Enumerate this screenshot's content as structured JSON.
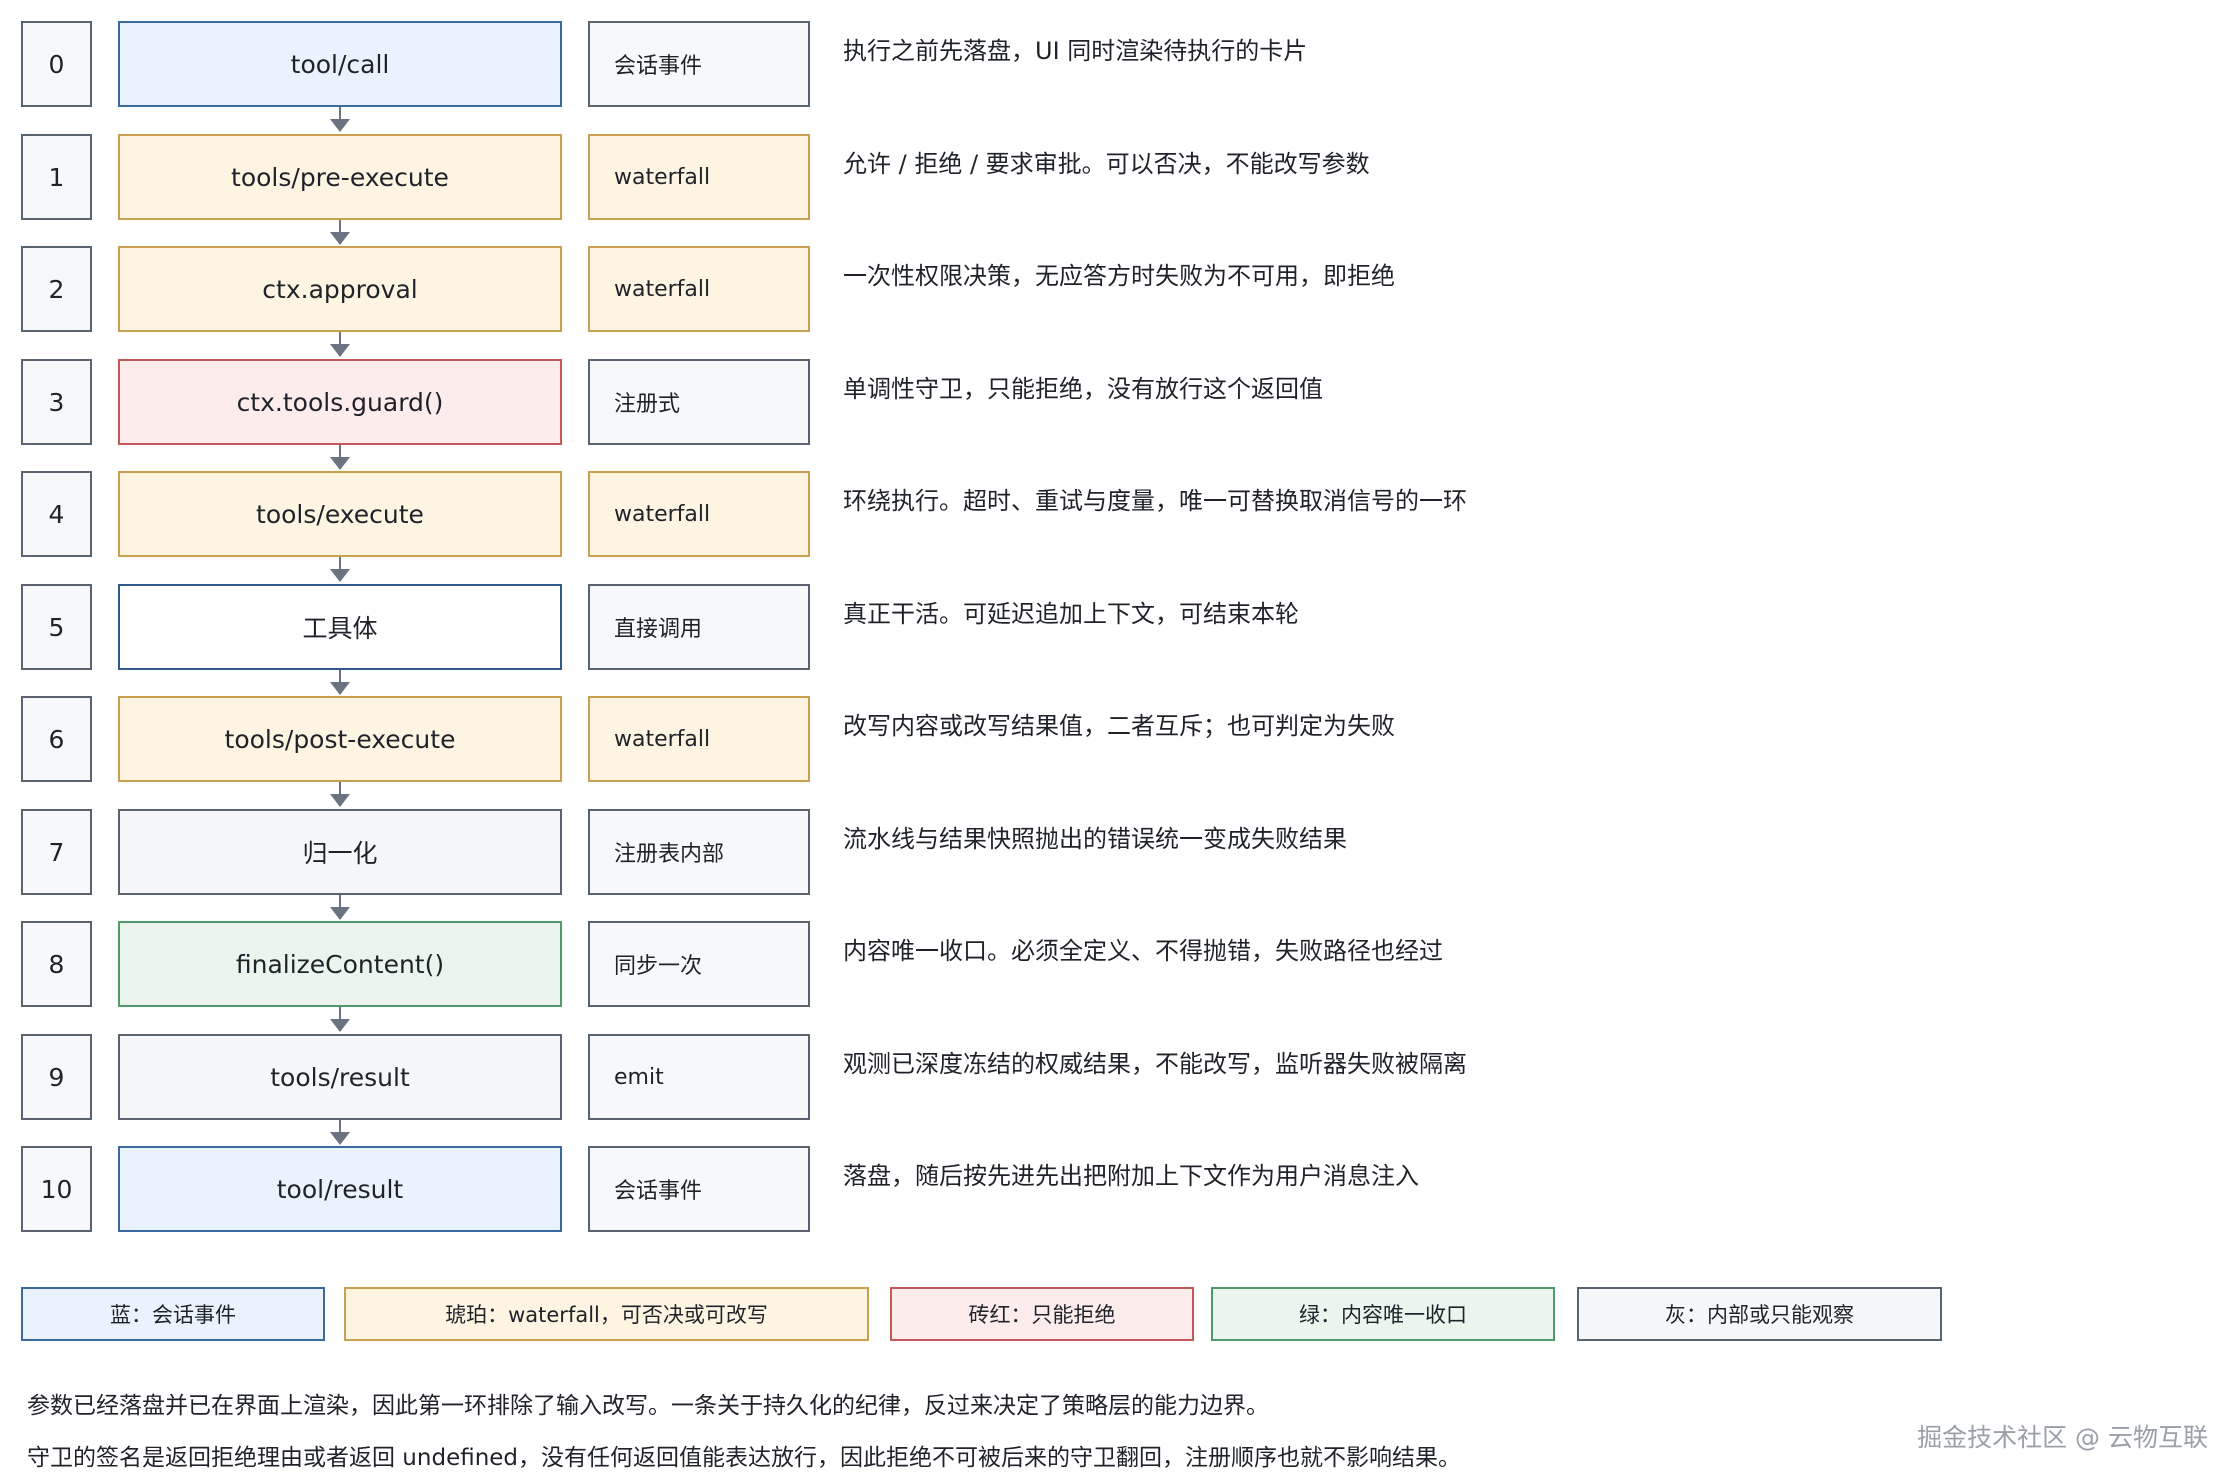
{
  "steps": [
    {
      "index": "0",
      "name": "tool/call",
      "kind": "会话事件",
      "desc": "执行之前先落盘，UI 同时渲染待执行的卡片",
      "color": "blue"
    },
    {
      "index": "1",
      "name": "tools/pre-execute",
      "kind": "waterfall",
      "desc": "允许 / 拒绝 / 要求审批。可以否决，不能改写参数",
      "color": "amber"
    },
    {
      "index": "2",
      "name": "ctx.approval",
      "kind": "waterfall",
      "desc": "一次性权限决策，无应答方时失败为不可用，即拒绝",
      "color": "amber"
    },
    {
      "index": "3",
      "name": "ctx.tools.guard()",
      "kind": "注册式",
      "desc": "单调性守卫，只能拒绝，没有放行这个返回值",
      "color": "red"
    },
    {
      "index": "4",
      "name": "tools/execute",
      "kind": "waterfall",
      "desc": "环绕执行。超时、重试与度量，唯一可替换取消信号的一环",
      "color": "amber"
    },
    {
      "index": "5",
      "name": "工具体",
      "kind": "直接调用",
      "desc": "真正干活。可延迟追加上下文，可结束本轮",
      "color": "white"
    },
    {
      "index": "6",
      "name": "tools/post-execute",
      "kind": "waterfall",
      "desc": "改写内容或改写结果值，二者互斥；也可判定为失败",
      "color": "amber"
    },
    {
      "index": "7",
      "name": "归一化",
      "kind": "注册表内部",
      "desc": "流水线与结果快照抛出的错误统一变成失败结果",
      "color": "gray"
    },
    {
      "index": "8",
      "name": "finalizeContent()",
      "kind": "同步一次",
      "desc": "内容唯一收口。必须全定义、不得抛错，失败路径也经过",
      "color": "green"
    },
    {
      "index": "9",
      "name": "tools/result",
      "kind": "emit",
      "desc": "观测已深度冻结的权威结果，不能改写，监听器失败被隔离",
      "color": "gray"
    },
    {
      "index": "10",
      "name": "tool/result",
      "kind": "会话事件",
      "desc": "落盘，随后按先进先出把附加上下文作为用户消息注入",
      "color": "blue"
    }
  ],
  "legend": [
    {
      "label": "蓝：会话事件",
      "color": "blue"
    },
    {
      "label": "琥珀：waterfall，可否决或可改写",
      "color": "amber"
    },
    {
      "label": "砖红：只能拒绝",
      "color": "red"
    },
    {
      "label": "绿：内容唯一收口",
      "color": "green"
    },
    {
      "label": "灰：内部或只能观察",
      "color": "gray"
    }
  ],
  "notes": {
    "line1": "参数已经落盘并已在界面上渲染，因此第一环排除了输入改写。一条关于持久化的纪律，反过来决定了策略层的能力边界。",
    "line2": "守卫的签名是返回拒绝理由或者返回 undefined，没有任何返回值能表达放行，因此拒绝不可被后来的守卫翻回，注册顺序也就不影响结果。"
  },
  "watermark": "掘金技术社区 @ 云物互联",
  "colors": {
    "blue": {
      "fill": "#eaf2fc",
      "border": "#3a6aa0"
    },
    "amber": {
      "fill": "#fdf5e1",
      "border": "#c9a050"
    },
    "red": {
      "fill": "#fcecec",
      "border": "#c45a5a"
    },
    "green": {
      "fill": "#eaf5ee",
      "border": "#4f9a6a"
    },
    "gray": {
      "fill": "#f6f7f9",
      "border": "#5a6470"
    },
    "white": {
      "fill": "#ffffff",
      "border": "#2f5a8a"
    }
  }
}
